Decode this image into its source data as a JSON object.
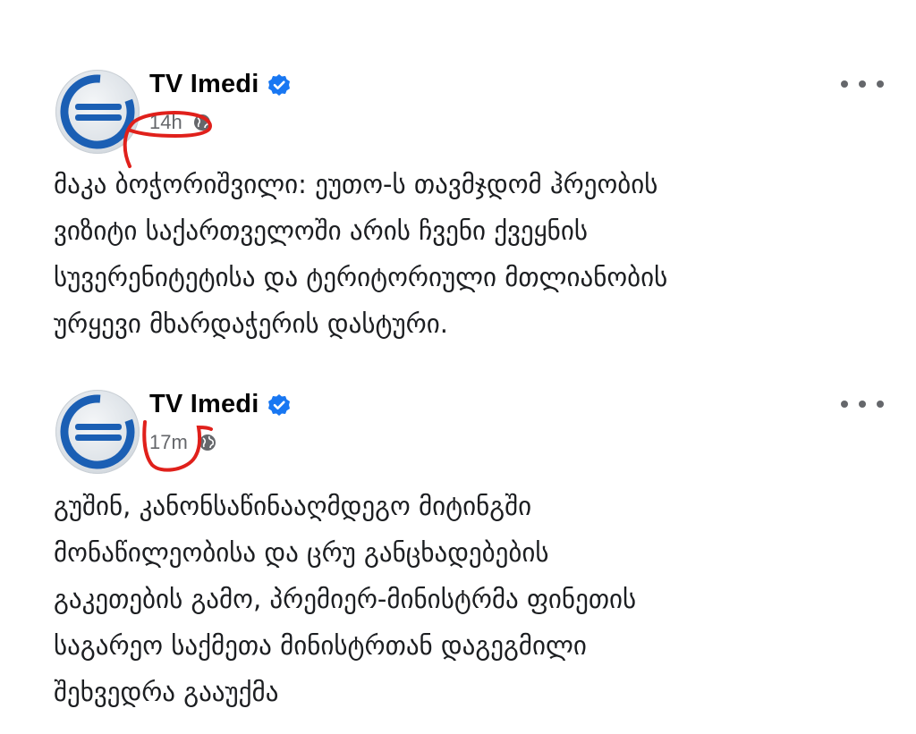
{
  "posts": [
    {
      "author": "TV Imedi",
      "timestamp": "14h",
      "text_lines": [
        "მაკა ბოჭორიშვილი: ეუთო-ს თავმჯდომ ჰრეობის",
        "ვიზიტი საქართველოში არის ჩვენი ქვეყნის",
        "სუვერენიტეტისა და ტერიტორიული მთლიანობის",
        "ურყევი მხარდაჭერის დასტური."
      ]
    },
    {
      "author": "TV Imedi",
      "timestamp": "17m",
      "text_lines": [
        "გუშინ, კანონსაწინააღმდეგო მიტინგში",
        "მონაწილეობისა და ცრუ განცხადებების",
        "გაკეთების გამო, პრემიერ-მინისტრმა ფინეთის",
        "საგარეო საქმეთა მინისტრთან დაგეგმილი",
        "შეხვედრა გააუქმა"
      ]
    }
  ],
  "colors": {
    "verified": "#1877f2",
    "annotation": "#e0201b",
    "meta": "#65676b"
  },
  "icons": {
    "verified": "verified-badge-icon",
    "audience": "globe-icon",
    "more": "more-options-icon"
  }
}
